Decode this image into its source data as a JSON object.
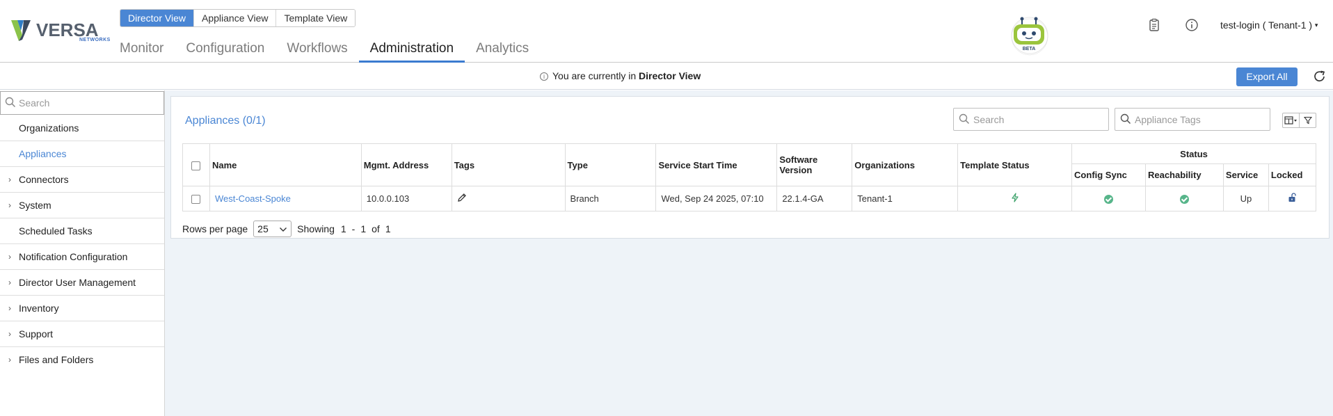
{
  "brand": {
    "name": "VERSA",
    "sub": "NETWORKS"
  },
  "view_switch": [
    "Director View",
    "Appliance View",
    "Template View"
  ],
  "main_tabs": [
    "Monitor",
    "Configuration",
    "Workflows",
    "Administration",
    "Analytics"
  ],
  "active_tab": "Administration",
  "bot_badge": "BETA",
  "user_menu": "test-login ( Tenant-1 )",
  "info": {
    "prefix": "You are currently in",
    "view": "Director View"
  },
  "export_label": "Export All",
  "sidebar": {
    "search_placeholder": "Search",
    "items": [
      {
        "label": "Organizations",
        "expandable": false
      },
      {
        "label": "Appliances",
        "expandable": false,
        "active": true
      },
      {
        "label": "Connectors",
        "expandable": true
      },
      {
        "label": "System",
        "expandable": true
      },
      {
        "label": "Scheduled Tasks",
        "expandable": false
      },
      {
        "label": "Notification Configuration",
        "expandable": true
      },
      {
        "label": "Director User Management",
        "expandable": true
      },
      {
        "label": "Inventory",
        "expandable": true
      },
      {
        "label": "Support",
        "expandable": true
      },
      {
        "label": "Files and Folders",
        "expandable": true
      }
    ]
  },
  "panel": {
    "title": "Appliances (0/1)",
    "search_placeholder": "Search",
    "tags_placeholder": "Appliance Tags"
  },
  "table": {
    "headers": {
      "name": "Name",
      "mgmt": "Mgmt. Address",
      "tags": "Tags",
      "type": "Type",
      "start": "Service Start Time",
      "software": "Software Version",
      "orgs": "Organizations",
      "template": "Template Status",
      "status": "Status",
      "config_sync": "Config Sync",
      "reachability": "Reachability",
      "service": "Service",
      "locked": "Locked"
    },
    "rows": [
      {
        "name": "West-Coast-Spoke",
        "mgmt": "10.0.0.103",
        "type": "Branch",
        "start": "Wed, Sep 24 2025, 07:10",
        "software": "22.1.4-GA",
        "orgs": "Tenant-1",
        "service": "Up"
      }
    ]
  },
  "pager": {
    "rows_label": "Rows per page",
    "rows_value": "25",
    "showing": "Showing",
    "from": "1",
    "dash": "-",
    "to": "1",
    "of": "of",
    "total": "1"
  }
}
